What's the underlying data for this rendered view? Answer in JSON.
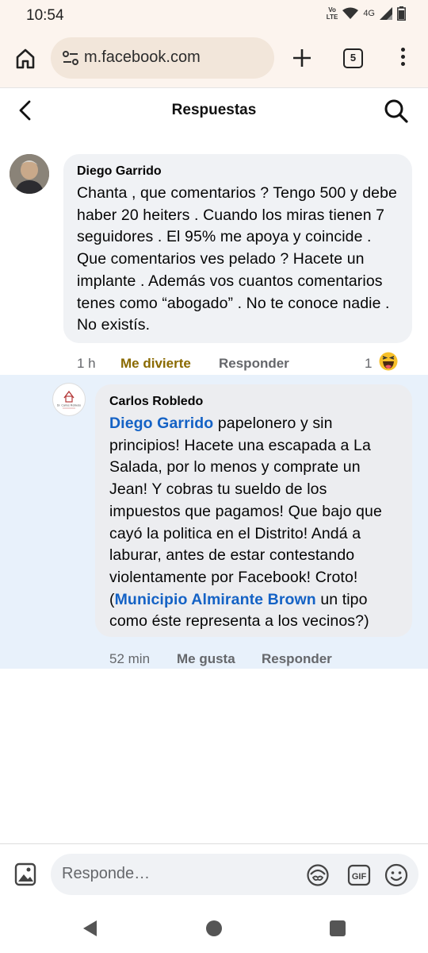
{
  "status_bar": {
    "time": "10:54",
    "volte_line1": "Vo",
    "volte_line2": "LTE",
    "network": "4G"
  },
  "browser": {
    "url": "m.facebook.com",
    "tab_count": "5"
  },
  "header": {
    "title": "Respuestas"
  },
  "comment": {
    "author": "Diego Garrido",
    "text": "Chanta , que comentarios ? Tengo 500 y debe haber 20 heiters . Cuando los miras tienen 7 seguidores . El 95% me apoya y coincide . Que comentarios ves pelado ? Hacete un implante . Además vos cuantos comentarios tenes como “abogado” . No te conoce nadie . No existís.",
    "time": "1 h",
    "reaction_label": "Me divierte",
    "reply_label": "Responder",
    "reaction_count": "1"
  },
  "reply": {
    "author": "Carlos Robledo",
    "mention1": "Diego Garrido",
    "text1": " papelonero y sin principios! Hacete una escapada a La Salada, por lo menos y comprate un Jean! Y cobras tu sueldo de los impuestos que pagamos! Que bajo que cayó la politica en el Distrito! Andá a laburar, antes de estar contestando violentamente por Facebook! Croto! (",
    "mention2": "Municipio Almirante Brown",
    "text2": " un tipo como éste representa a los vecinos?)",
    "time": "52 min",
    "like_label": "Me gusta",
    "reply_label": "Responder",
    "avatar_logo_text": "Dr. Carlos Robledo"
  },
  "composer": {
    "placeholder": "Responde…"
  },
  "colors": {
    "mention": "#1462c5",
    "reaction_active": "#8a6a00",
    "reply_highlight": "#e8f1fb",
    "bubble": "#f0f2f5",
    "browser_bar": "#fcf4ee"
  },
  "icons": {
    "browser": [
      "home-icon",
      "tune-icon",
      "plus-icon",
      "tabs-icon",
      "more-vert-icon"
    ],
    "header": [
      "back-arrow-icon",
      "search-icon"
    ],
    "composer": [
      "image-icon",
      "avatar-sticker-icon",
      "gif-icon",
      "emoji-icon"
    ],
    "navigation": [
      "nav-back-icon",
      "nav-home-icon",
      "nav-recents-icon"
    ]
  }
}
